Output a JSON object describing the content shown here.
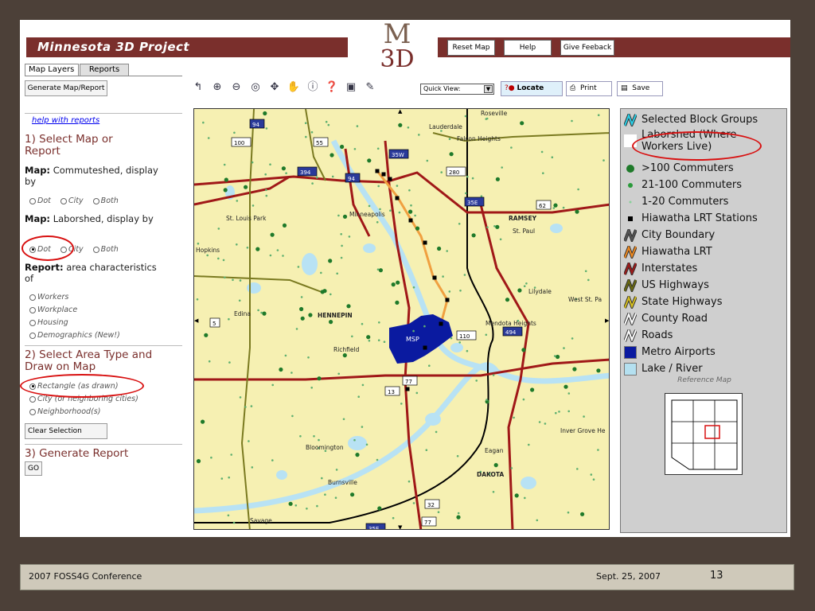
{
  "header": {
    "title": "Minnesota 3D Project",
    "logo_top": "M",
    "logo_bottom": "3D"
  },
  "topbar": {
    "buttons": [
      "Reset Map",
      "Help",
      "Give Feeback"
    ]
  },
  "tabs": [
    "Map Layers",
    "Reports"
  ],
  "left": {
    "generate_btn": "Generate Map/Report",
    "help_link": "help with reports",
    "step1": "1) Select Map or Report",
    "commuteshed_label": "Map:",
    "commuteshed_text": "Commuteshed, display by",
    "commuteshed_opts": [
      "Dot",
      "City",
      "Both"
    ],
    "laborshed_label": "Map:",
    "laborshed_text": "Laborshed, display by",
    "laborshed_opts": [
      "Dot",
      "City",
      "Both"
    ],
    "report_label": "Report:",
    "report_text": "area characteristics of",
    "report_opts": [
      "Workers",
      "Workplace",
      "Housing",
      "Demographics (New!)"
    ],
    "step2": "2) Select Area Type and Draw on Map",
    "area_opts": [
      "Rectangle (as drawn)",
      "City (or neighboring cities)",
      "Neighborhood(s)"
    ],
    "clear_btn": "Clear Selection",
    "step3": "3) Generate Report",
    "go_btn": "GO"
  },
  "toolbar": {
    "icons": [
      "back-icon",
      "zoom-in-icon",
      "zoom-out-icon",
      "full-extent-icon",
      "pan-cross-icon",
      "hand-pan-icon",
      "identify-icon",
      "query-icon",
      "overview-icon",
      "measure-icon"
    ],
    "quickview": "Quick View:",
    "locate": "Locate",
    "print": "Print",
    "save": "Save"
  },
  "map": {
    "places": [
      "Roseville",
      "Lauderdale",
      "Falcon Heights",
      "St. Louis Park",
      "Minneapolis",
      "RAMSEY",
      "St. Paul",
      "Hopkins",
      "Lilydale",
      "West St. Pa",
      "Edina",
      "HENNEPIN",
      "Mendota Heights",
      "Richfield",
      "MSP",
      "Inver Grove He",
      "Bloomington",
      "Eagan",
      "DAKOTA",
      "Burnsville",
      "Savage"
    ],
    "shields": [
      "94",
      "100",
      "55",
      "35W",
      "280",
      "394",
      "94",
      "35E",
      "62",
      "5",
      "110",
      "494",
      "77",
      "13",
      "35E",
      "32",
      "77"
    ]
  },
  "legend": {
    "items": [
      {
        "label": "Selected Block Groups",
        "sym": "zig",
        "color": "#2ad0e8"
      },
      {
        "label": "Laborshed (Where Workers Live)",
        "sym": "none",
        "color": "#ffffff"
      },
      {
        "label": ">100 Commuters",
        "sym": "dot-lg",
        "color": "#1f7a2a"
      },
      {
        "label": "21-100 Commuters",
        "sym": "dot-md",
        "color": "#2a9a3a"
      },
      {
        "label": "1-20 Commuters",
        "sym": "dot-sm",
        "color": "#8ad09a"
      },
      {
        "label": "Hiawatha LRT Stations",
        "sym": "sq",
        "color": "#000000"
      },
      {
        "label": "City Boundary",
        "sym": "zig",
        "color": "#555555"
      },
      {
        "label": "Hiawatha LRT",
        "sym": "zig",
        "color": "#f08a20"
      },
      {
        "label": "Interstates",
        "sym": "zig",
        "color": "#a01818"
      },
      {
        "label": "US Highways",
        "sym": "zig",
        "color": "#6a6a10"
      },
      {
        "label": "State Highways",
        "sym": "zig",
        "color": "#d8c020"
      },
      {
        "label": "County Road",
        "sym": "zig",
        "color": "#ffffff"
      },
      {
        "label": "Roads",
        "sym": "zig",
        "color": "#ffffff"
      },
      {
        "label": "Metro Airports",
        "sym": "box",
        "color": "#0a1aa0"
      },
      {
        "label": "Lake / River",
        "sym": "box",
        "color": "#b4e0f0"
      }
    ],
    "ref_title": "Reference Map"
  },
  "footer": {
    "left": "2007 FOSS4G Conference",
    "date": "Sept. 25, 2007",
    "page": "13"
  }
}
